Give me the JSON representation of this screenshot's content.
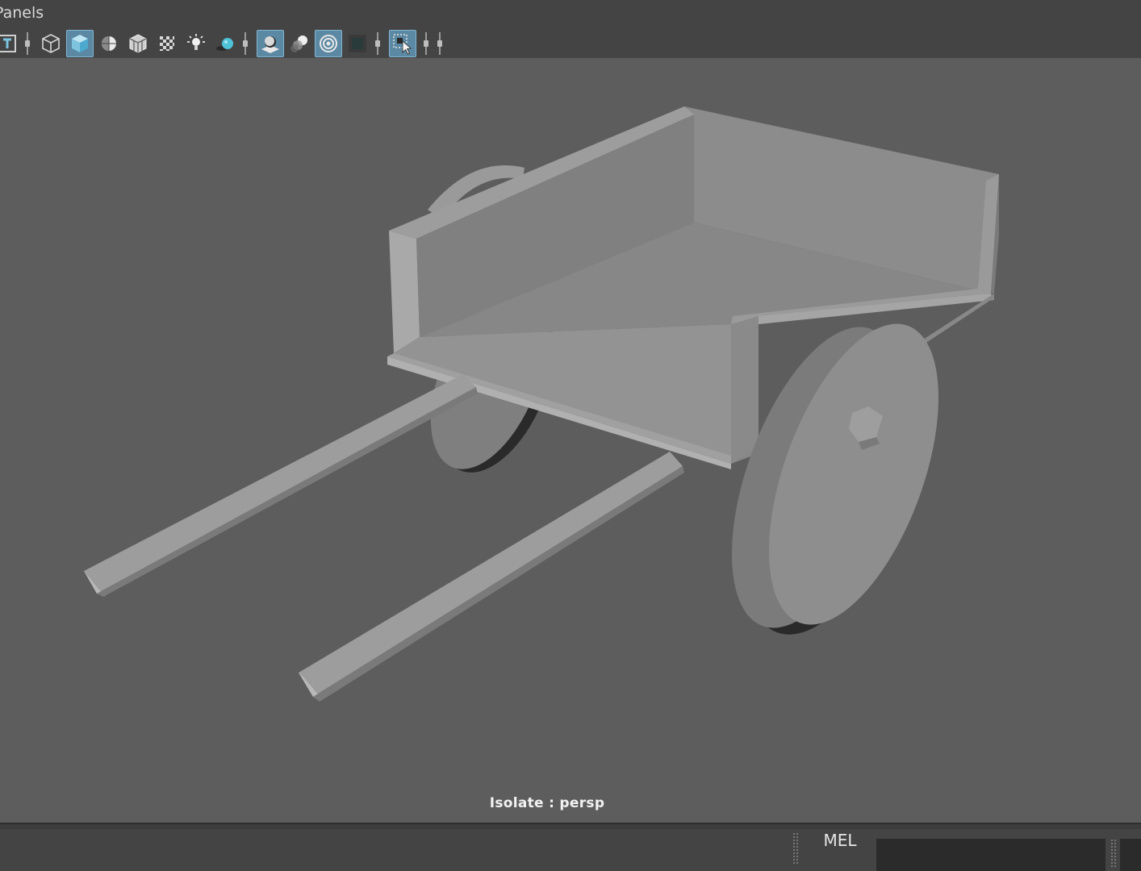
{
  "menubar": {
    "panels_label": "Panels"
  },
  "toolbar": {
    "buttons": [
      {
        "name": "text-overlay-icon",
        "active": false
      },
      {
        "name": "wireframe-icon",
        "active": false
      },
      {
        "name": "smooth-shade-icon",
        "active": true
      },
      {
        "name": "shaded-wireframe-icon",
        "active": false
      },
      {
        "name": "bounding-box-icon",
        "active": false
      },
      {
        "name": "textured-icon",
        "active": false
      },
      {
        "name": "use-all-lights-icon",
        "active": false
      },
      {
        "name": "shadows-icon",
        "active": false
      },
      {
        "name": "screen-space-ao-icon",
        "active": true
      },
      {
        "name": "motion-blur-icon",
        "active": false
      },
      {
        "name": "antialiasing-icon",
        "active": true
      },
      {
        "name": "depth-of-field-icon",
        "active": false
      },
      {
        "name": "isolate-select-icon",
        "active": true
      }
    ]
  },
  "viewport": {
    "isolate_text": "Isolate : persp"
  },
  "command_line": {
    "language_label": "MEL",
    "input_value": ""
  },
  "colors": {
    "accent": "#5b88a3",
    "panel": "#444444",
    "viewport_bg": "#5d5d5d"
  }
}
